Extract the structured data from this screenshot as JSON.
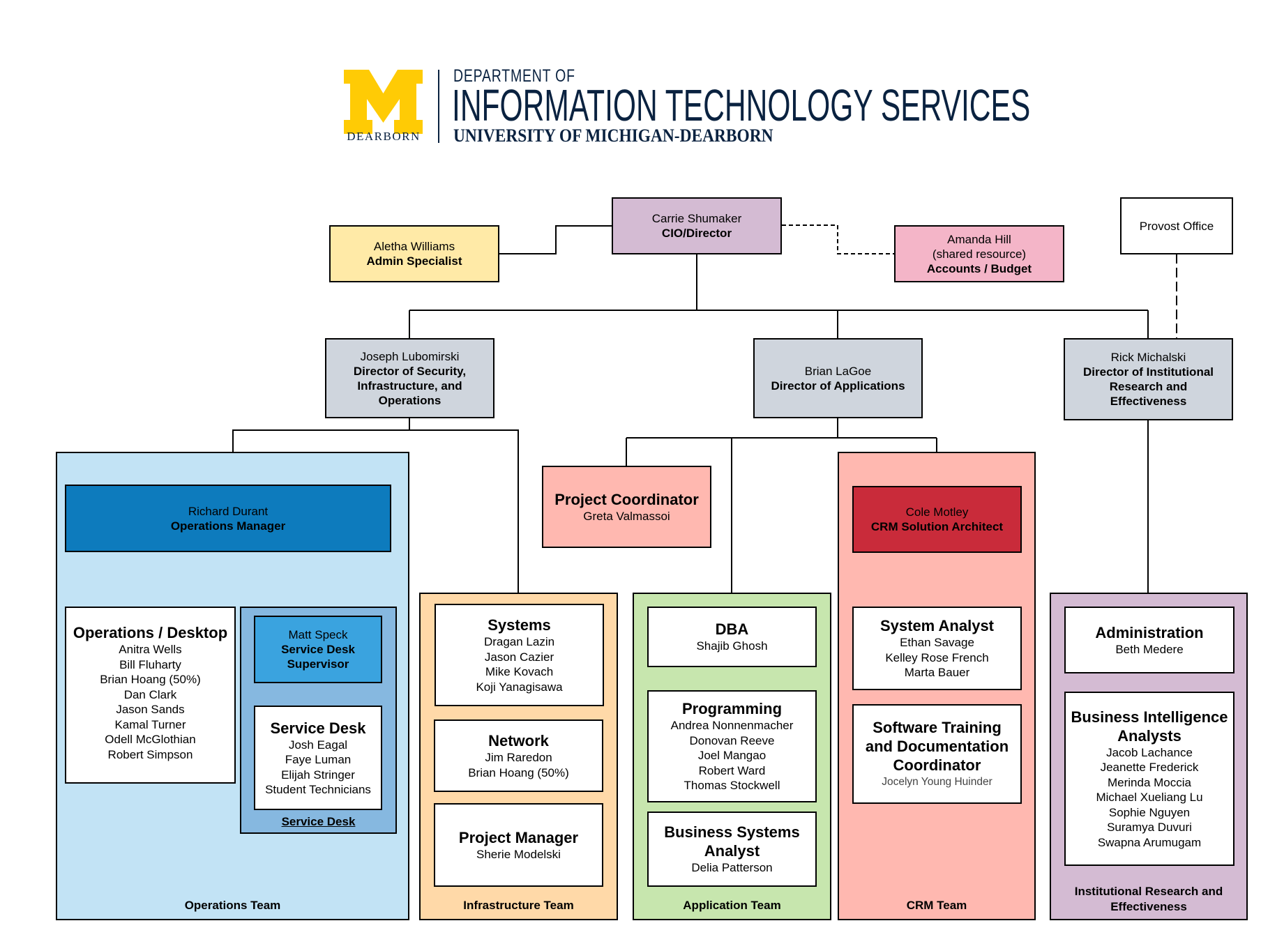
{
  "header": {
    "logo_letter": "M",
    "logo_campus": "DEARBORN",
    "dept_prefix": "DEPARTMENT OF",
    "dept_name": "INFORMATION TECHNOLOGY SERVICES",
    "university": "UNIVERSITY OF MICHIGAN-DEARBORN"
  },
  "colors": {
    "logo_maize": "#FFCB05",
    "logo_navy": "#0A2240",
    "cio": "#D4BBD3",
    "admin": "#FFEAA7",
    "accounts": "#F4B5C8",
    "director": "#CFD5DD",
    "operations_team": "#C2E3F5",
    "operations_manager": "#0D7BBD",
    "service_desk_group": "#86B8E0",
    "service_desk_supervisor": "#3AA3DF",
    "infrastructure_team": "#FFD9A8",
    "application_team": "#C7E6AE",
    "crm_team": "#FFB8B0",
    "crm_architect": "#C92B3A",
    "project_coordinator": "#FFB8B0",
    "ir_team": "#D4BBD3"
  },
  "leadership": {
    "cio": {
      "name": "Carrie Shumaker",
      "title": "CIO/Director"
    },
    "admin": {
      "name": "Aletha Williams",
      "title": "Admin Specialist"
    },
    "accounts": {
      "name": "Amanda Hill",
      "note": "(shared resource)",
      "title": "Accounts / Budget"
    },
    "provost": {
      "name": "Provost Office"
    }
  },
  "directors": [
    {
      "name": "Joseph Lubomirski",
      "title_lines": [
        "Director of Security,",
        "Infrastructure, and",
        "Operations"
      ]
    },
    {
      "name": "Brian LaGoe",
      "title_lines": [
        "Director of Applications"
      ]
    },
    {
      "name": "Rick Michalski",
      "title_lines": [
        "Director of Institutional",
        "Research and",
        "Effectiveness"
      ]
    }
  ],
  "project_coordinator": {
    "title": "Project Coordinator",
    "name": "Greta Valmassoi"
  },
  "teams": {
    "operations": {
      "label": "Operations Team",
      "manager": {
        "name": "Richard Durant",
        "title": "Operations Manager"
      },
      "desktop": {
        "title": "Operations / Desktop",
        "members": [
          "Anitra Wells",
          "Bill Fluharty",
          "Brian Hoang (50%)",
          "Dan Clark",
          "Jason Sands",
          "Kamal Turner",
          "Odell McGlothian",
          "Robert Simpson"
        ]
      },
      "service_desk_group": {
        "label": "Service Desk",
        "supervisor": {
          "name": "Matt Speck",
          "title_lines": [
            "Service Desk",
            "Supervisor"
          ]
        },
        "unit": {
          "title": "Service Desk",
          "members": [
            "Josh Eagal",
            "Faye Luman",
            "Elijah Stringer",
            "Student Technicians"
          ]
        }
      }
    },
    "infrastructure": {
      "label": "Infrastructure Team",
      "units": [
        {
          "title": "Systems",
          "members": [
            "Dragan Lazin",
            "Jason Cazier",
            "Mike Kovach",
            "Koji Yanagisawa"
          ]
        },
        {
          "title": "Network",
          "members": [
            "Jim Raredon",
            "Brian Hoang (50%)"
          ]
        },
        {
          "title": "Project Manager",
          "members": [
            "Sherie Modelski"
          ]
        }
      ]
    },
    "application": {
      "label": "Application Team",
      "units": [
        {
          "title": "DBA",
          "members": [
            "Shajib Ghosh"
          ]
        },
        {
          "title": "Programming",
          "members": [
            "Andrea Nonnenmacher",
            "Donovan Reeve",
            "Joel Mangao",
            "Robert Ward",
            "Thomas Stockwell"
          ]
        },
        {
          "title_lines": [
            "Business Systems",
            "Analyst"
          ],
          "members": [
            "Delia Patterson"
          ]
        }
      ]
    },
    "crm": {
      "label": "CRM Team",
      "architect": {
        "name": "Cole Motley",
        "title": "CRM Solution Architect"
      },
      "units": [
        {
          "title": "System Analyst",
          "members": [
            "Ethan Savage",
            "Kelley Rose French",
            "Marta Bauer"
          ]
        },
        {
          "title_lines": [
            "Software Training",
            "and Documentation",
            "Coordinator"
          ],
          "members": [
            "Jocelyn Young Huinder"
          ]
        }
      ]
    },
    "institutional_research": {
      "label_lines": [
        "Institutional Research and",
        "Effectiveness"
      ],
      "units": [
        {
          "title": "Administration",
          "members": [
            "Beth Medere"
          ]
        },
        {
          "title_lines": [
            "Business Intelligence",
            "Analysts"
          ],
          "members": [
            "Jacob Lachance",
            "Jeanette Frederick",
            "Merinda Moccia",
            "Michael Xueliang Lu",
            "Sophie Nguyen",
            "Suramya Duvuri",
            "Swapna Arumugam"
          ]
        }
      ]
    }
  }
}
